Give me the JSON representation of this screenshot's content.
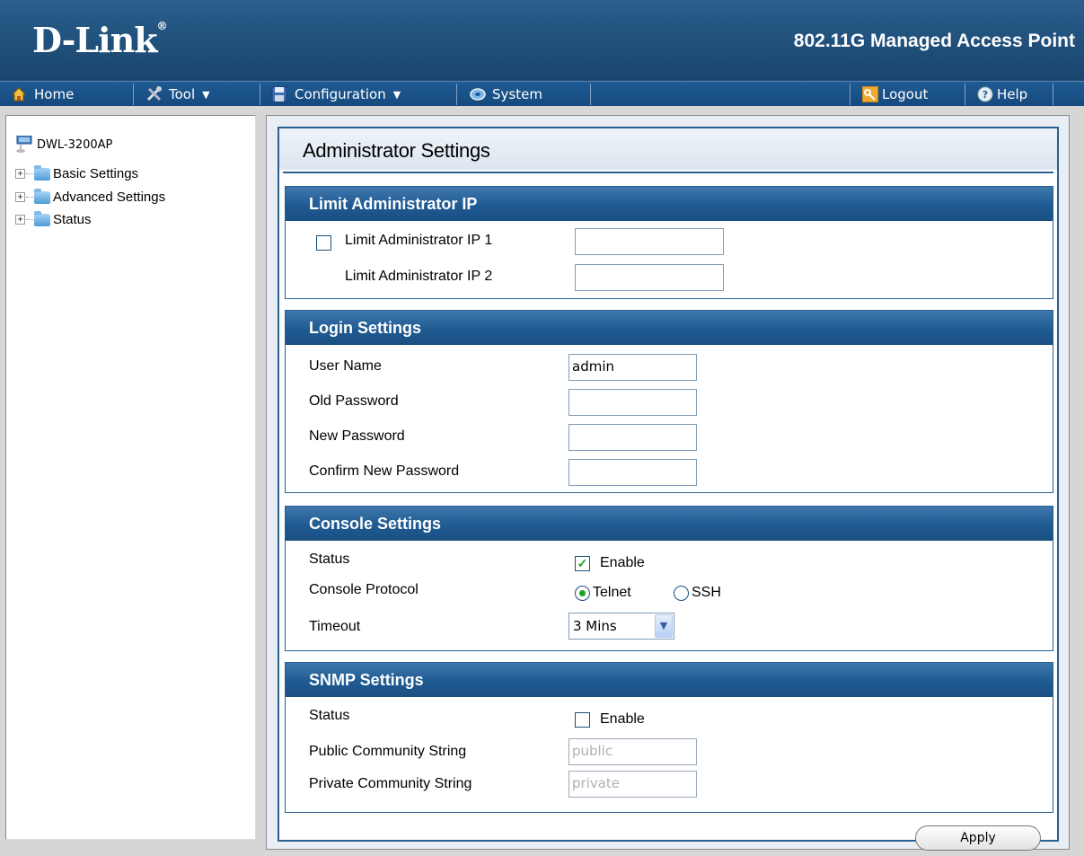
{
  "header": {
    "logo": "D-Link",
    "product_title": "802.11G Managed Access Point"
  },
  "toolbar": {
    "home": "Home",
    "tool": "Tool",
    "configuration": "Configuration",
    "system": "System",
    "logout": "Logout",
    "help": "Help"
  },
  "sidebar": {
    "root": "DWL-3200AP",
    "items": [
      {
        "label": "Basic Settings"
      },
      {
        "label": "Advanced Settings"
      },
      {
        "label": "Status"
      }
    ]
  },
  "page": {
    "title": "Administrator Settings"
  },
  "limit_ip": {
    "heading": "Limit Administrator IP",
    "ip1_label": "Limit Administrator IP 1",
    "ip1_value": "",
    "ip1_checked": false,
    "ip2_label": "Limit Administrator IP 2",
    "ip2_value": ""
  },
  "login": {
    "heading": "Login Settings",
    "username_label": "User Name",
    "username_value": "admin",
    "old_password_label": "Old Password",
    "new_password_label": "New Password",
    "confirm_password_label": "Confirm New Password"
  },
  "console": {
    "heading": "Console Settings",
    "status_label": "Status",
    "enable_label": "Enable",
    "enable_checked": true,
    "protocol_label": "Console Protocol",
    "telnet_label": "Telnet",
    "ssh_label": "SSH",
    "protocol_selected": "Telnet",
    "timeout_label": "Timeout",
    "timeout_value": "3 Mins"
  },
  "snmp": {
    "heading": "SNMP Settings",
    "status_label": "Status",
    "enable_label": "Enable",
    "enable_checked": false,
    "public_label": "Public Community String",
    "public_value": "public",
    "private_label": "Private Community String",
    "private_value": "private"
  },
  "actions": {
    "apply": "Apply"
  }
}
